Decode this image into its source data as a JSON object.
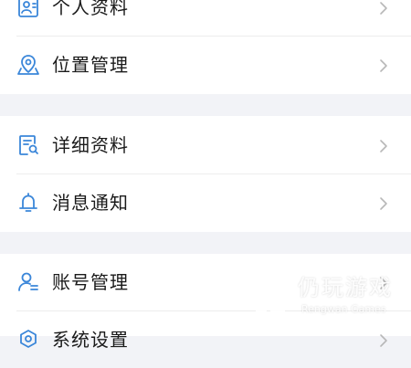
{
  "menu": {
    "groups": [
      {
        "items": [
          {
            "label": "个人资料",
            "icon": "profile-card-icon"
          },
          {
            "label": "位置管理",
            "icon": "map-location-icon"
          }
        ]
      },
      {
        "items": [
          {
            "label": "详细资料",
            "icon": "document-search-icon"
          },
          {
            "label": "消息通知",
            "icon": "bell-icon"
          }
        ]
      },
      {
        "items": [
          {
            "label": "账号管理",
            "icon": "user-manage-icon"
          },
          {
            "label": "系统设置",
            "icon": "settings-icon"
          }
        ]
      }
    ]
  },
  "watermark": {
    "name": "仍玩游戏",
    "subtitle": "Rengwan Games"
  },
  "colors": {
    "accent_icon": "#3a86d9",
    "text": "#1a1a1a",
    "chevron": "#b8b8b8",
    "group_gap": "#f2f3f7",
    "divider": "#ededed"
  }
}
